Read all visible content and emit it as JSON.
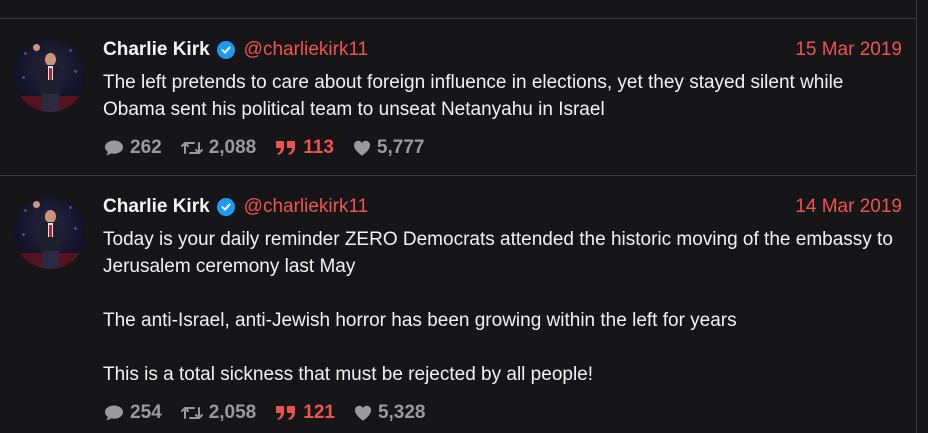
{
  "tweets": [
    {
      "name": "Charlie Kirk",
      "handle": "@charliekirk11",
      "date": "15 Mar 2019",
      "paragraphs": [
        "The left pretends to care about foreign influence in elections, yet they stayed silent while Obama sent his political team to unseat Netanyahu in Israel"
      ],
      "stats": {
        "replies": "262",
        "retweets": "2,088",
        "quotes": "113",
        "likes": "5,777"
      }
    },
    {
      "name": "Charlie Kirk",
      "handle": "@charliekirk11",
      "date": "14 Mar 2019",
      "paragraphs": [
        "Today is your daily reminder ZERO Democrats attended the historic moving of the embassy to Jerusalem ceremony last May",
        "The anti-Israel, anti-Jewish horror has been growing within the left for years",
        "This is a total sickness that must be rejected by all people!"
      ],
      "stats": {
        "replies": "254",
        "retweets": "2,058",
        "quotes": "121",
        "likes": "5,328"
      }
    }
  ],
  "icons": {
    "reply": "speech-bubble-icon",
    "retweet": "retweet-icon",
    "quote": "quote-icon",
    "like": "heart-icon",
    "verified": "verified-badge-icon"
  },
  "colors": {
    "background": "#161618",
    "accent": "#ef5350",
    "verified": "#1d9bf0",
    "muted": "#9a9a9a",
    "divider": "#3a3a3c"
  }
}
